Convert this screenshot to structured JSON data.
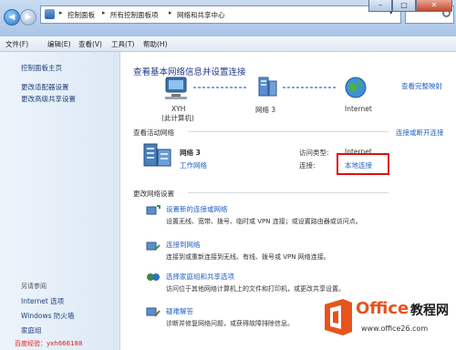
{
  "address": {
    "crumbs": [
      "控制面板",
      "所有控制面板项",
      "网络和共享中心"
    ]
  },
  "window": {
    "min": "–",
    "max": "□",
    "close": "✕"
  },
  "menu": [
    "文件(F)",
    "编辑(E)",
    "查看(V)",
    "工具(T)",
    "帮助(H)"
  ],
  "sidebar": {
    "home": "控制面板主页",
    "links": [
      "更改适配器设置",
      "更改高级共享设置"
    ],
    "see_also": "另请参阅",
    "see_also_links": [
      "Internet 选项",
      "Windows 防火墙",
      "家庭组"
    ],
    "footer_text": "百度经验：yxh666188"
  },
  "main": {
    "title": "查看基本网络信息并设置连接",
    "full_map_link": "查看完整映射",
    "map": {
      "computer_name": "XYH",
      "computer_sub": "(此计算机)",
      "network_name": "网络  3",
      "internet": "Internet"
    },
    "active_header": "查看活动网络",
    "connect_link": "连接或断开连接",
    "network": {
      "name": "网络  3",
      "type": "工作网络",
      "access_label": "访问类型:",
      "access_value": "Internet",
      "conn_label": "连接:",
      "conn_value": "本地连接"
    },
    "change_header": "更改网络设置",
    "tasks": [
      {
        "title": "设置新的连接或网络",
        "desc": "设置无线、宽带、拨号、临时或 VPN 连接；或设置路由器或访问点。"
      },
      {
        "title": "连接到网络",
        "desc": "连接到或重新连接到无线、有线、拨号或 VPN 网络连接。"
      },
      {
        "title": "选择家庭组和共享选项",
        "desc": "访问位于其他网络计算机上的文件和打印机，或更改共享设置。"
      },
      {
        "title": "疑难解答",
        "desc": "诊断并修复网络问题，或获得故障排除信息。"
      }
    ],
    "logo": {
      "brand_word": "Office",
      "brand_cn": "教程网",
      "url": "www.office26.com"
    }
  }
}
